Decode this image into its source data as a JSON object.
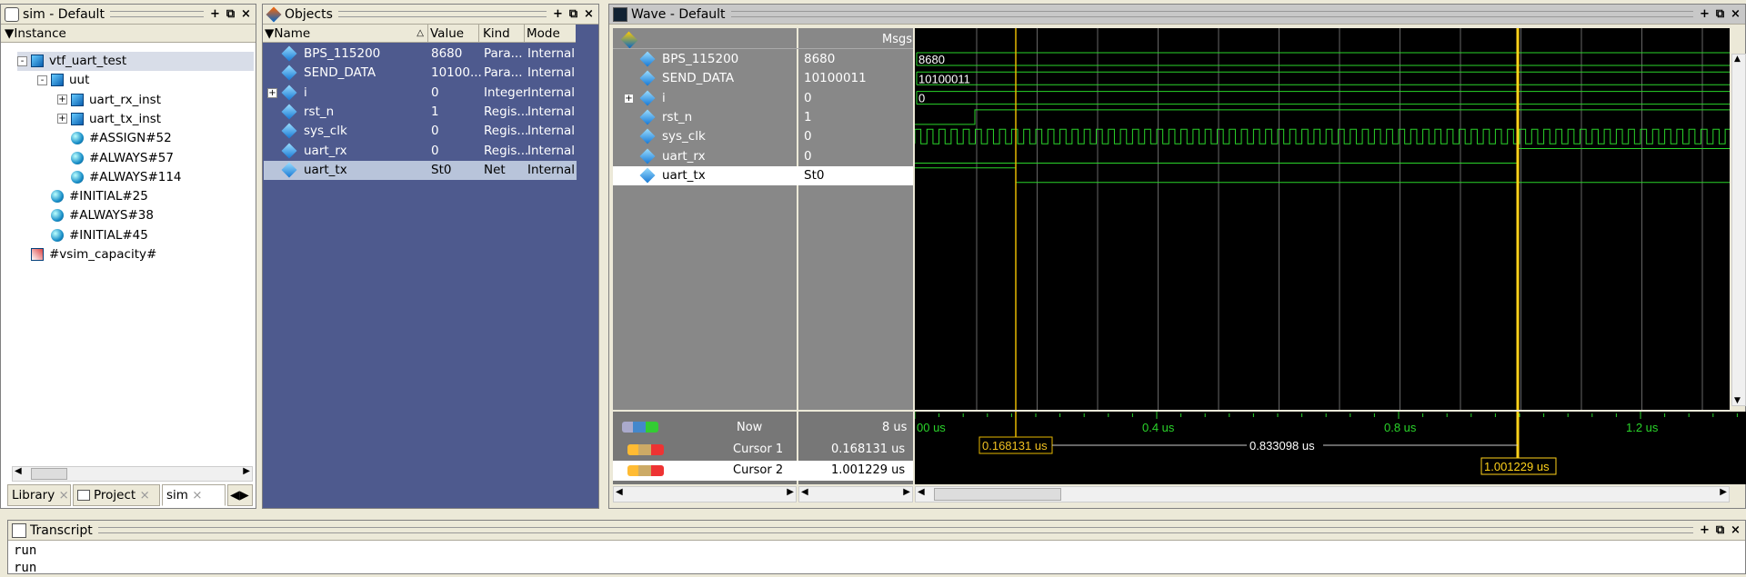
{
  "sim_pane": {
    "title": "sim - Default",
    "col_instance": "Instance",
    "tree": [
      {
        "label": "vtf_uart_test",
        "kind": "cube",
        "indent": 0,
        "expander": "-"
      },
      {
        "label": "uut",
        "kind": "cube",
        "indent": 1,
        "expander": "-"
      },
      {
        "label": "uart_rx_inst",
        "kind": "cube",
        "indent": 2,
        "expander": "+"
      },
      {
        "label": "uart_tx_inst",
        "kind": "cube",
        "indent": 2,
        "expander": "+"
      },
      {
        "label": "#ASSIGN#52",
        "kind": "sphere",
        "indent": 2,
        "expander": ""
      },
      {
        "label": "#ALWAYS#57",
        "kind": "sphere",
        "indent": 2,
        "expander": ""
      },
      {
        "label": "#ALWAYS#114",
        "kind": "sphere",
        "indent": 2,
        "expander": ""
      },
      {
        "label": "#INITIAL#25",
        "kind": "sphere",
        "indent": 1,
        "expander": ""
      },
      {
        "label": "#ALWAYS#38",
        "kind": "sphere",
        "indent": 1,
        "expander": ""
      },
      {
        "label": "#INITIAL#45",
        "kind": "sphere",
        "indent": 1,
        "expander": ""
      },
      {
        "label": "#vsim_capacity#",
        "kind": "chart",
        "indent": 0,
        "expander": ""
      }
    ],
    "tabs": [
      "Library",
      "Project",
      "sim"
    ]
  },
  "objects_pane": {
    "title": "Objects",
    "columns": [
      "Name",
      "Value",
      "Kind",
      "Mode"
    ],
    "rows": [
      {
        "name": "BPS_115200",
        "value": "8680",
        "kind": "Para...",
        "mode": "Internal"
      },
      {
        "name": "SEND_DATA",
        "value": "10100...",
        "kind": "Para...",
        "mode": "Internal"
      },
      {
        "name": "i",
        "value": "0",
        "kind": "Integer",
        "mode": "Internal"
      },
      {
        "name": "rst_n",
        "value": "1",
        "kind": "Regis...",
        "mode": "Internal"
      },
      {
        "name": "sys_clk",
        "value": "0",
        "kind": "Regis...",
        "mode": "Internal"
      },
      {
        "name": "uart_rx",
        "value": "0",
        "kind": "Regis...",
        "mode": "Internal"
      },
      {
        "name": "uart_tx",
        "value": "St0",
        "kind": "Net",
        "mode": "Internal"
      }
    ]
  },
  "wave_pane": {
    "title": "Wave - Default",
    "msgs_label": "Msgs",
    "signals": [
      {
        "name": "BPS_115200",
        "value": "8680",
        "wave_text": "8680"
      },
      {
        "name": "SEND_DATA",
        "value": "10100011",
        "wave_text": "10100011"
      },
      {
        "name": "i",
        "value": "0",
        "wave_text": "0"
      },
      {
        "name": "rst_n",
        "value": "1",
        "wave_text": ""
      },
      {
        "name": "sys_clk",
        "value": "0",
        "wave_text": ""
      },
      {
        "name": "uart_rx",
        "value": "0",
        "wave_text": ""
      },
      {
        "name": "uart_tx",
        "value": "St0",
        "wave_text": ""
      }
    ],
    "now_label": "Now",
    "now_value": "8 us",
    "cursor1_label": "Cursor 1",
    "cursor1_value": "0.168131 us",
    "cursor2_label": "Cursor 2",
    "cursor2_value": "1.001229 us",
    "time_ticks": [
      "00 us",
      "0.4 us",
      "0.8 us",
      "1.2 us"
    ],
    "cursor1_flag": "0.168131 us",
    "cursor2_flag": "1.001229 us",
    "delta_label": "0.833098 us"
  },
  "transcript": {
    "title": "Transcript",
    "lines": [
      "run",
      "run"
    ]
  }
}
